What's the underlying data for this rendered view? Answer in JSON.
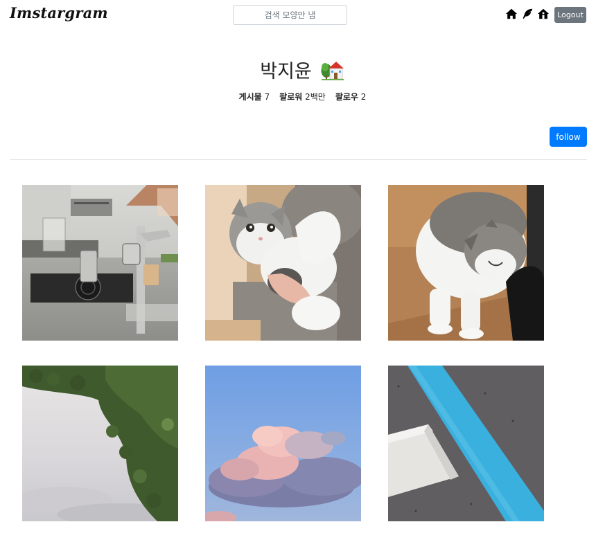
{
  "brand": {
    "name": "Imstargram"
  },
  "search": {
    "placeholder": "검색 모양만 냄",
    "value": ""
  },
  "nav": {
    "icons": [
      "home-icon",
      "feather-icon",
      "house-alt-icon"
    ],
    "logout_label": "Logout"
  },
  "profile": {
    "name": "박지윤",
    "emoji_icon": "house-with-garden-icon",
    "stats": [
      {
        "label": "게시물",
        "value": "7"
      },
      {
        "label": "팔로워",
        "value": "2백만"
      },
      {
        "label": "팔로우",
        "value": "2"
      }
    ],
    "follow_label": "follow"
  },
  "posts": [
    {
      "subject": "coffee-machine"
    },
    {
      "subject": "cat-held"
    },
    {
      "subject": "cat-walking"
    },
    {
      "subject": "trees-sky"
    },
    {
      "subject": "pink-cloud"
    },
    {
      "subject": "blue-line-asphalt"
    }
  ],
  "colors": {
    "follow": "#007bff",
    "logout": "#6c757d"
  }
}
